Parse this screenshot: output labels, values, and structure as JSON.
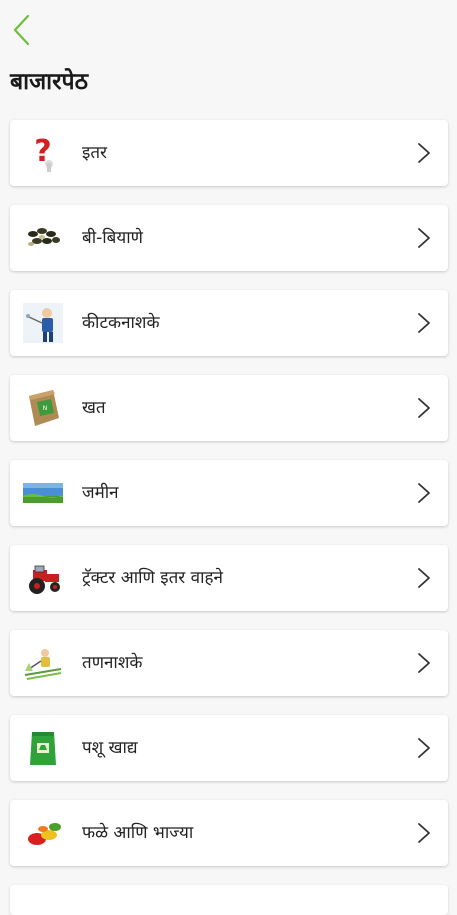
{
  "header": {
    "back_icon": "chevron-left-icon",
    "title": "बाजारपेठ"
  },
  "colors": {
    "accent": "#6dbf3b",
    "background": "#f7f7f7",
    "card": "#ffffff"
  },
  "categories": [
    {
      "label": "इतर",
      "icon": "question-mark-icon"
    },
    {
      "label": "बी-बियाणे",
      "icon": "seeds-icon"
    },
    {
      "label": "कीटकनाशके",
      "icon": "pesticide-sprayer-icon"
    },
    {
      "label": "खत",
      "icon": "fertilizer-bag-icon"
    },
    {
      "label": "जमीन",
      "icon": "land-icon"
    },
    {
      "label": "ट्रॅक्टर आणि इतर वाहने",
      "icon": "tractor-icon"
    },
    {
      "label": "तणनाशके",
      "icon": "herbicide-icon"
    },
    {
      "label": "पशू खाद्य",
      "icon": "animal-feed-icon"
    },
    {
      "label": "फळे आणि भाज्या",
      "icon": "fruits-vegetables-icon"
    }
  ]
}
